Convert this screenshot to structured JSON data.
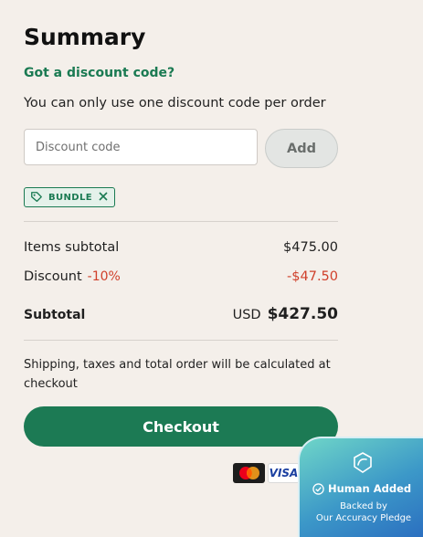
{
  "summary": {
    "title": "Summary",
    "discount_link": "Got a discount code?",
    "discount_note": "You can only use one discount code per order",
    "discount_input_placeholder": "Discount code",
    "add_button": "Add",
    "applied_code": "BUNDLE"
  },
  "totals": {
    "items_subtotal_label": "Items subtotal",
    "items_subtotal_value": "$475.00",
    "discount_label": "Discount",
    "discount_percent": "-10%",
    "discount_value": "-$47.50",
    "subtotal_label": "Subtotal",
    "currency": "USD",
    "subtotal_value": "$427.50"
  },
  "shipping_note": "Shipping, taxes and total order will be calculated at checkout",
  "checkout_button": "Checkout",
  "payment_icons": [
    "mastercard-icon",
    "visa-icon",
    "amex-icon"
  ],
  "visa_text": "VISA",
  "badge": {
    "title": "Human Added",
    "line1": "Backed by",
    "line2": "Our Accuracy Pledge"
  },
  "colors": {
    "accent_green": "#1c7a54",
    "negative_red": "#d0402b",
    "background": "#f4efea"
  }
}
